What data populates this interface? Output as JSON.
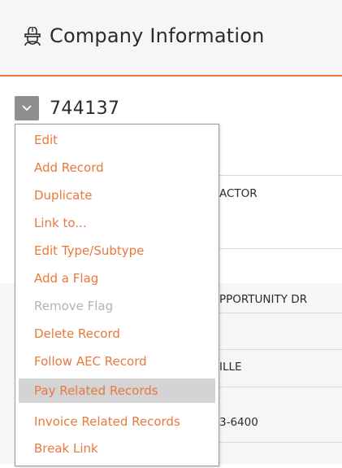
{
  "header": {
    "title": "Company Information",
    "icon": "company-building-icon"
  },
  "record": {
    "id": "744137"
  },
  "background_fields": {
    "contractor_partial": "ACTOR",
    "opportunity_partial": "PPORTUNITY DR",
    "city_partial": "ILLE",
    "phone_partial": "3-6400"
  },
  "menu": {
    "items": [
      {
        "label": "Edit"
      },
      {
        "label": "Add Record"
      },
      {
        "label": "Duplicate"
      },
      {
        "label": "Link to..."
      },
      {
        "label": "Edit Type/Subtype"
      },
      {
        "label": "Add a Flag"
      },
      {
        "label": "Remove Flag",
        "disabled": true
      },
      {
        "label": "Delete Record"
      },
      {
        "label": "Follow AEC Record"
      },
      {
        "label": "Pay Related Records",
        "highlighted": true
      },
      {
        "label": "Invoice Related Records"
      },
      {
        "label": "Break Link"
      }
    ]
  },
  "colors": {
    "accent": "#e8783c",
    "disabled": "#b3b3b3",
    "highlight": "#d4d4d4",
    "header_bg": "#f6f6f6"
  }
}
